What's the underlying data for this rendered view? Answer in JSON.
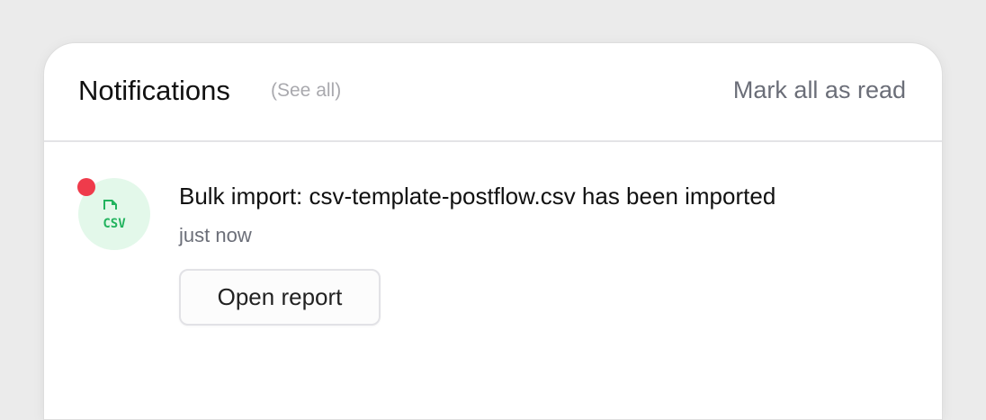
{
  "header": {
    "title": "Notifications",
    "see_all_label": "(See all)",
    "mark_all_read_label": "Mark all as read"
  },
  "notifications": [
    {
      "icon": "csv-file-icon",
      "icon_text": "CSV",
      "unread": true,
      "message": "Bulk import: csv-template-postflow.csv has been imported",
      "time": "just now",
      "action_label": "Open report"
    }
  ],
  "colors": {
    "unread_dot": "#ef3b4b",
    "icon_bg": "#e3f8ea",
    "icon_fg": "#22b35e",
    "muted_text": "#6b6e78",
    "subtle_text": "#a9a9ae"
  }
}
